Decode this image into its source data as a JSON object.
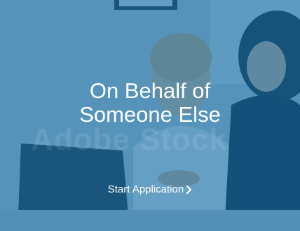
{
  "card": {
    "title_line1": "On Behalf of",
    "title_line2": "Someone Else",
    "cta_label": "Start Application",
    "cta_icon": "chevron-right-icon",
    "watermark_text": "Adobe Stock",
    "overlay_color": "#106ca8",
    "text_color": "#ffffff"
  }
}
